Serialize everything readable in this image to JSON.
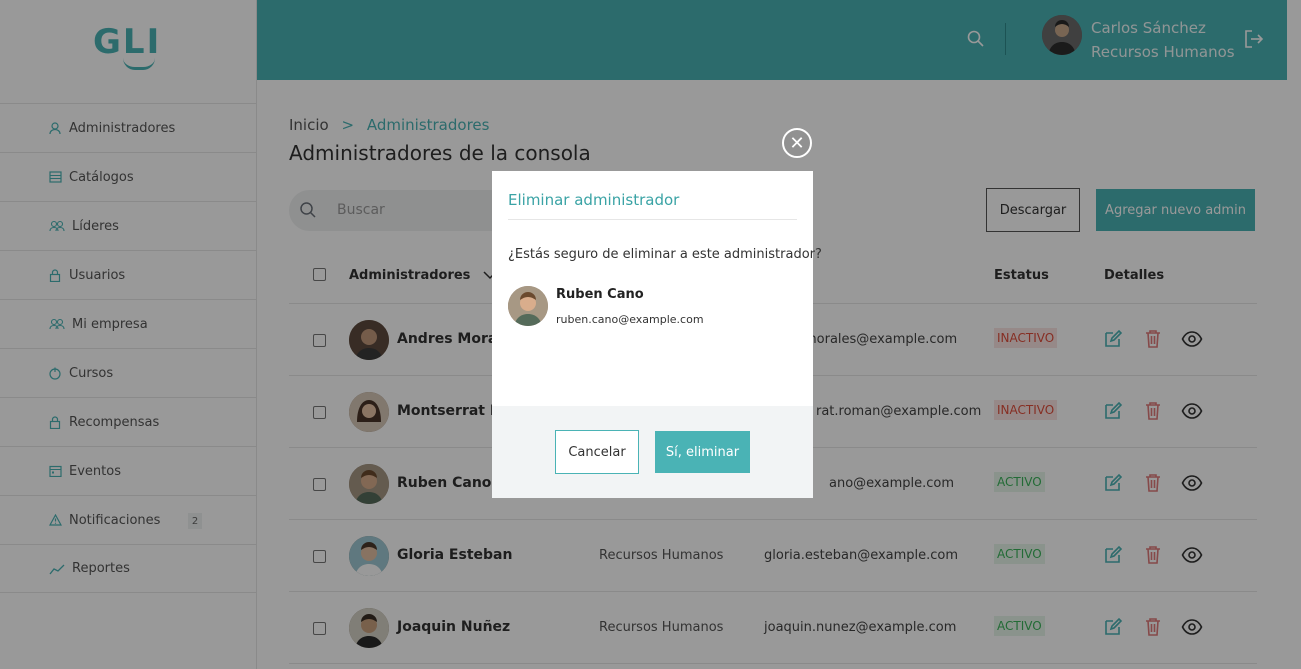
{
  "brand": {
    "logo_text": "GLI",
    "accent": "#4ab3b5"
  },
  "sidebar": {
    "items": [
      {
        "label": "Administradores",
        "icon": "user-icon"
      },
      {
        "label": "Catálogos",
        "icon": "catalog-icon"
      },
      {
        "label": "Líderes",
        "icon": "group-icon"
      },
      {
        "label": "Usuarios",
        "icon": "lock-user-icon"
      },
      {
        "label": "Mi empresa",
        "icon": "company-icon"
      },
      {
        "label": "Cursos",
        "icon": "course-icon"
      },
      {
        "label": "Recompensas",
        "icon": "reward-icon"
      },
      {
        "label": "Eventos",
        "icon": "calendar-icon"
      },
      {
        "label": "Notificaciones",
        "icon": "warning-icon",
        "badge": "2"
      },
      {
        "label": "Reportes",
        "icon": "chart-line-icon"
      }
    ]
  },
  "header": {
    "user_name": "Carlos Sánchez",
    "user_role": "Recursos Humanos"
  },
  "main": {
    "breadcrumb": {
      "home": "Inicio",
      "sep": ">",
      "current": "Administradores"
    },
    "title": "Administradores de la consola",
    "search": {
      "placeholder": "Buscar",
      "value": ""
    },
    "download_label": "Descargar",
    "add_label": "Agregar nuevo admin",
    "table": {
      "headers": {
        "admins": "Administradores",
        "status": "Estatus",
        "details": "Detalles"
      },
      "rows": [
        {
          "name": "Andres Morales",
          "dept": "",
          "email": "andres.morales@example.com",
          "email_visible": "morales@example.com",
          "status": "INACTIVO"
        },
        {
          "name": "Montserrat Roman",
          "dept": "",
          "email": "montserrat.roman@example.com",
          "email_visible": "rat.roman@example.com",
          "status": "INACTIVO"
        },
        {
          "name": "Ruben Cano",
          "dept": "",
          "email": "ruben.cano@example.com",
          "email_visible": "ano@example.com",
          "status": "ACTIVO"
        },
        {
          "name": "Gloria Esteban",
          "dept": "Recursos Humanos",
          "email": "gloria.esteban@example.com",
          "email_visible": "gloria.esteban@example.com",
          "status": "ACTIVO"
        },
        {
          "name": "Joaquin Nuñez",
          "dept": "Recursos Humanos",
          "email": "joaquin.nunez@example.com",
          "email_visible": "joaquin.nunez@example.com",
          "status": "ACTIVO"
        }
      ]
    }
  },
  "modal": {
    "close_symbol": "✕",
    "title": "Eliminar administrador",
    "question": "¿Estás seguro de eliminar a este administrador?",
    "user_name": "Ruben Cano",
    "user_email": "ruben.cano@example.com",
    "cancel_label": "Cancelar",
    "confirm_label": "Sí, eliminar"
  }
}
